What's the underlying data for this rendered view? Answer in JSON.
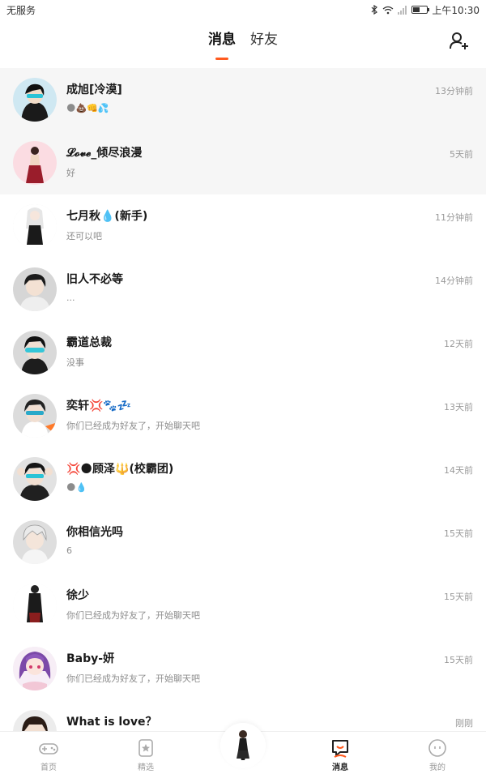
{
  "status_bar": {
    "carrier": "无服务",
    "time": "上午10:30",
    "battery_level": 0.45
  },
  "header": {
    "tabs": [
      {
        "label": "消息",
        "active": true
      },
      {
        "label": "好友",
        "active": false
      }
    ],
    "add_friend_icon": "add-user-icon"
  },
  "conversations": [
    {
      "name": "成旭[冷漠]",
      "preview": "🌑💩👊💦",
      "time": "13分钟前",
      "pinned": true,
      "avatar": "bg-cyan-hair-dark"
    },
    {
      "name": "𝓛𝓸𝓿𝓮_倾尽浪漫",
      "preview": "好",
      "time": "5天前",
      "pinned": true,
      "avatar": "pink-bg-girl-red-dress"
    },
    {
      "name": "七月秋💧(新手)",
      "preview": "还可以吧",
      "time": "11分钟前",
      "pinned": false,
      "avatar": "white-hair-girl-black-dress"
    },
    {
      "name": "旧人不必等",
      "preview": "...",
      "time": "14分钟前",
      "pinned": false,
      "avatar": "dark-hair-boy-grey-bg"
    },
    {
      "name": "霸道总裁",
      "preview": "没事",
      "time": "12天前",
      "pinned": false,
      "avatar": "boy-cyan-glasses"
    },
    {
      "name": "奕轩💢🐾💤",
      "preview": "你们已经成为好友了，开始聊天吧",
      "time": "13天前",
      "pinned": false,
      "avatar": "boy-glasses-orange"
    },
    {
      "name": "💢🌑顾泽🔱(校霸团)",
      "preview": "🌑💧",
      "time": "14天前",
      "pinned": false,
      "avatar": "boy-hands-on-head"
    },
    {
      "name": "你相信光吗",
      "preview": "6",
      "time": "15天前",
      "pinned": false,
      "avatar": "white-hair-boy"
    },
    {
      "name": "徐少",
      "preview": "你们已经成为好友了，开始聊天吧",
      "time": "15天前",
      "pinned": false,
      "avatar": "boy-black-coat-full"
    },
    {
      "name": "Baby-妍",
      "preview": "你们已经成为好友了，开始聊天吧",
      "time": "15天前",
      "pinned": false,
      "avatar": "purple-hair-girl"
    },
    {
      "name": "What is love？",
      "preview": "",
      "time": "刚刚",
      "pinned": false,
      "avatar": "dark-hair-partial"
    }
  ],
  "bottom_nav": {
    "items": [
      {
        "label": "首页",
        "icon": "gamepad-icon",
        "active": false
      },
      {
        "label": "精选",
        "icon": "star-card-icon",
        "active": false
      },
      {
        "label": "",
        "icon": "center-avatar",
        "active": false
      },
      {
        "label": "消息",
        "icon": "chat-bubble-icon",
        "active": true
      },
      {
        "label": "我的",
        "icon": "face-icon",
        "active": false
      }
    ]
  },
  "colors": {
    "accent": "#ff5a1f",
    "pinned_bg": "#f6f6f6",
    "muted_text": "#999999"
  }
}
